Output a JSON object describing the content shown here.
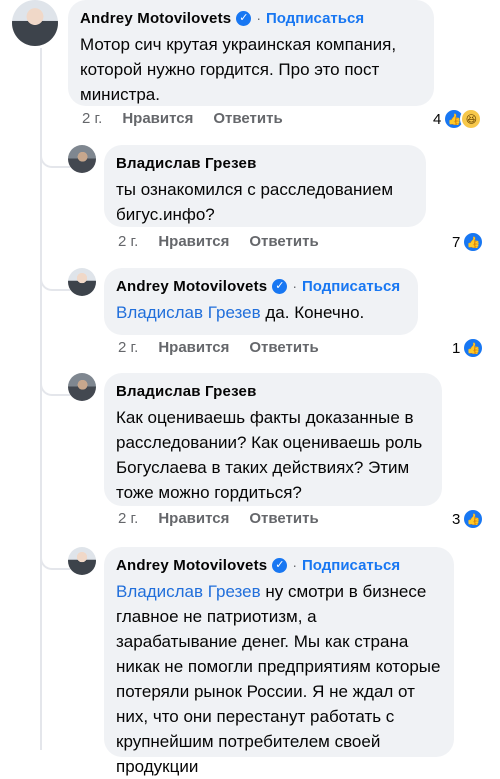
{
  "comments": [
    {
      "author": "Andrey Motovilovets",
      "follow": "Подписаться",
      "dot": "·",
      "text": "Мотор сич крутая украинская компания, которой нужно гордится. Про это пост министра.",
      "time": "2 г.",
      "like": "Нравится",
      "reply": "Ответить",
      "reactions_count": "4",
      "reaction_icons": [
        "like-icon",
        "haha-icon"
      ]
    },
    {
      "author": "Владислав Грезев",
      "text": "ты ознакомился с расследованием бигус.инфо?",
      "time": "2 г.",
      "like": "Нравится",
      "reply": "Ответить",
      "reactions_count": "7",
      "reaction_icons": [
        "like-icon"
      ]
    },
    {
      "author": "Andrey Motovilovets",
      "follow": "Подписаться",
      "dot": "·",
      "mention": "Владислав Грезев",
      "text": "да. Конечно.",
      "time": "2 г.",
      "like": "Нравится",
      "reply": "Ответить",
      "reactions_count": "1",
      "reaction_icons": [
        "like-icon"
      ]
    },
    {
      "author": "Владислав Грезев",
      "text": "Как оцениваешь факты доказанные в расследовании? Как оцениваешь роль Богуслаева в таких действиях? Этим тоже можно гордиться?",
      "time": "2 г.",
      "like": "Нравится",
      "reply": "Ответить",
      "reactions_count": "3",
      "reaction_icons": [
        "like-icon"
      ]
    },
    {
      "author": "Andrey Motovilovets",
      "follow": "Подписаться",
      "dot": "·",
      "mention": "Владислав Грезев",
      "text": "ну смотри в бизнесе главное не патриотизм, а зарабатывание денег. Мы как страна никак не помогли предприятиям которые потеряли рынок России. Я не ждал от них, что они перестанут работать с крупнейшим потребителем своей продукции"
    }
  ],
  "colors": {
    "accent": "#1877f2",
    "bubble": "#f0f2f5",
    "muted": "#65676b"
  }
}
